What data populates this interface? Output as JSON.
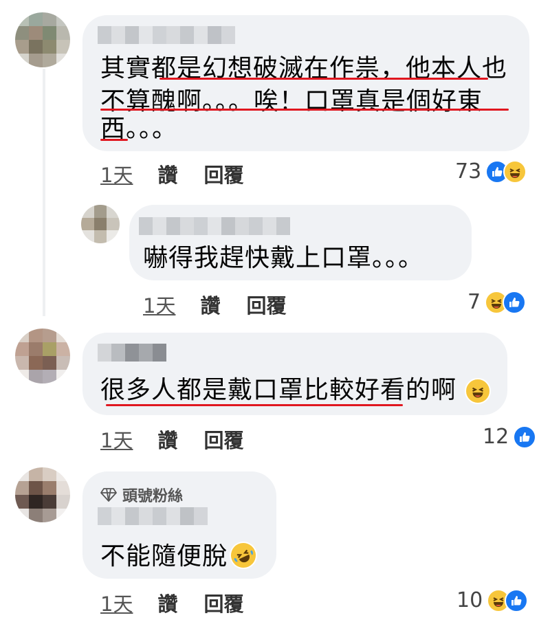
{
  "comments": [
    {
      "text_lines": [
        "其實都是幻想破滅在作祟，他本人也",
        "不算醜啊。。。唉！口罩真是個好東",
        "西。。。"
      ],
      "time": "1天",
      "like_label": "讚",
      "reply_label": "回覆",
      "reaction_count": "73",
      "reactions": [
        "like-icon",
        "haha-icon"
      ]
    },
    {
      "text_lines": [
        "嚇得我趕快戴上口罩。。。"
      ],
      "time": "1天",
      "like_label": "讚",
      "reply_label": "回覆",
      "reaction_count": "7",
      "reactions": [
        "haha-icon",
        "like-icon"
      ]
    },
    {
      "text_lines": [
        "很多人都是戴口罩比較好看的啊"
      ],
      "time": "1天",
      "like_label": "讚",
      "reply_label": "回覆",
      "reaction_count": "12",
      "reactions": [
        "like-icon"
      ]
    },
    {
      "badge": "頭號粉絲",
      "text_lines": [
        "不能隨便脫"
      ],
      "time": "1天",
      "like_label": "讚",
      "reply_label": "回覆",
      "reaction_count": "10",
      "reactions": [
        "haha-icon",
        "like-icon"
      ]
    }
  ],
  "colors": {
    "bubble": "#f0f2f5",
    "underline": "#e0161f",
    "like": "#1877f2",
    "haha": "#f7c63b"
  }
}
